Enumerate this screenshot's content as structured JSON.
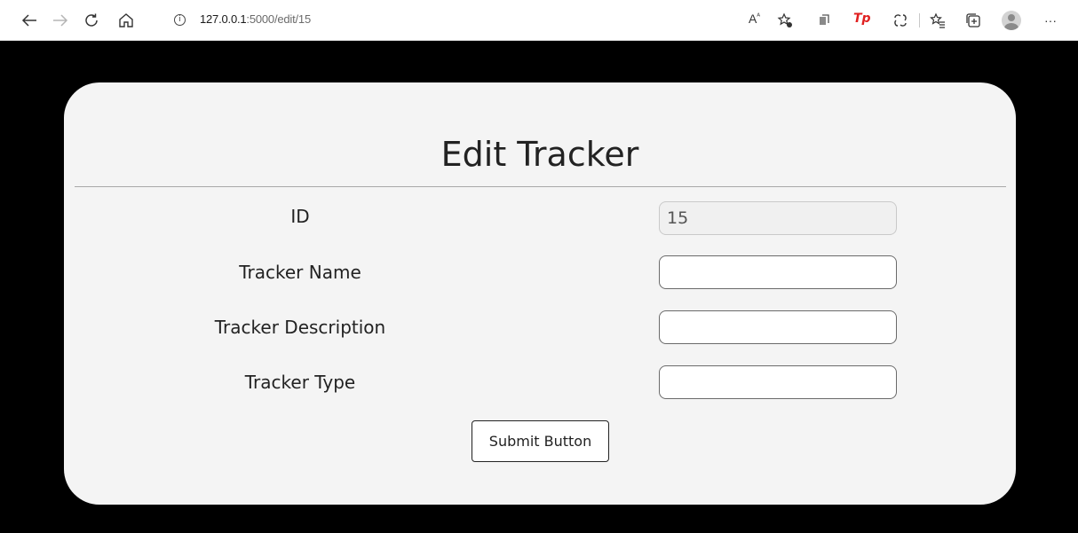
{
  "browser": {
    "url_host": "127.0.0.1",
    "url_path": ":5000/edit/15",
    "toolbar_icons": [
      "back-icon",
      "forward-icon",
      "refresh-icon",
      "home-icon",
      "info-icon",
      "read-aloud-icon",
      "add-favorite-icon",
      "extensions-icon",
      "tp-extension-icon",
      "copilot-icon",
      "favorites-icon",
      "collections-icon",
      "profile-icon",
      "more-icon"
    ],
    "reader_label": "A",
    "tp_label": "Tp",
    "more_label": "···"
  },
  "form": {
    "title": "Edit Tracker",
    "fields": [
      {
        "label": "ID",
        "value": "15",
        "readonly": true
      },
      {
        "label": "Tracker Name",
        "value": ""
      },
      {
        "label": "Tracker Description",
        "value": ""
      },
      {
        "label": "Tracker Type",
        "value": ""
      }
    ],
    "submit_label": "Submit Button"
  },
  "colors": {
    "page_background": "#000000",
    "card_background": "#f4f4f4",
    "tp_brand": "#e02020"
  }
}
